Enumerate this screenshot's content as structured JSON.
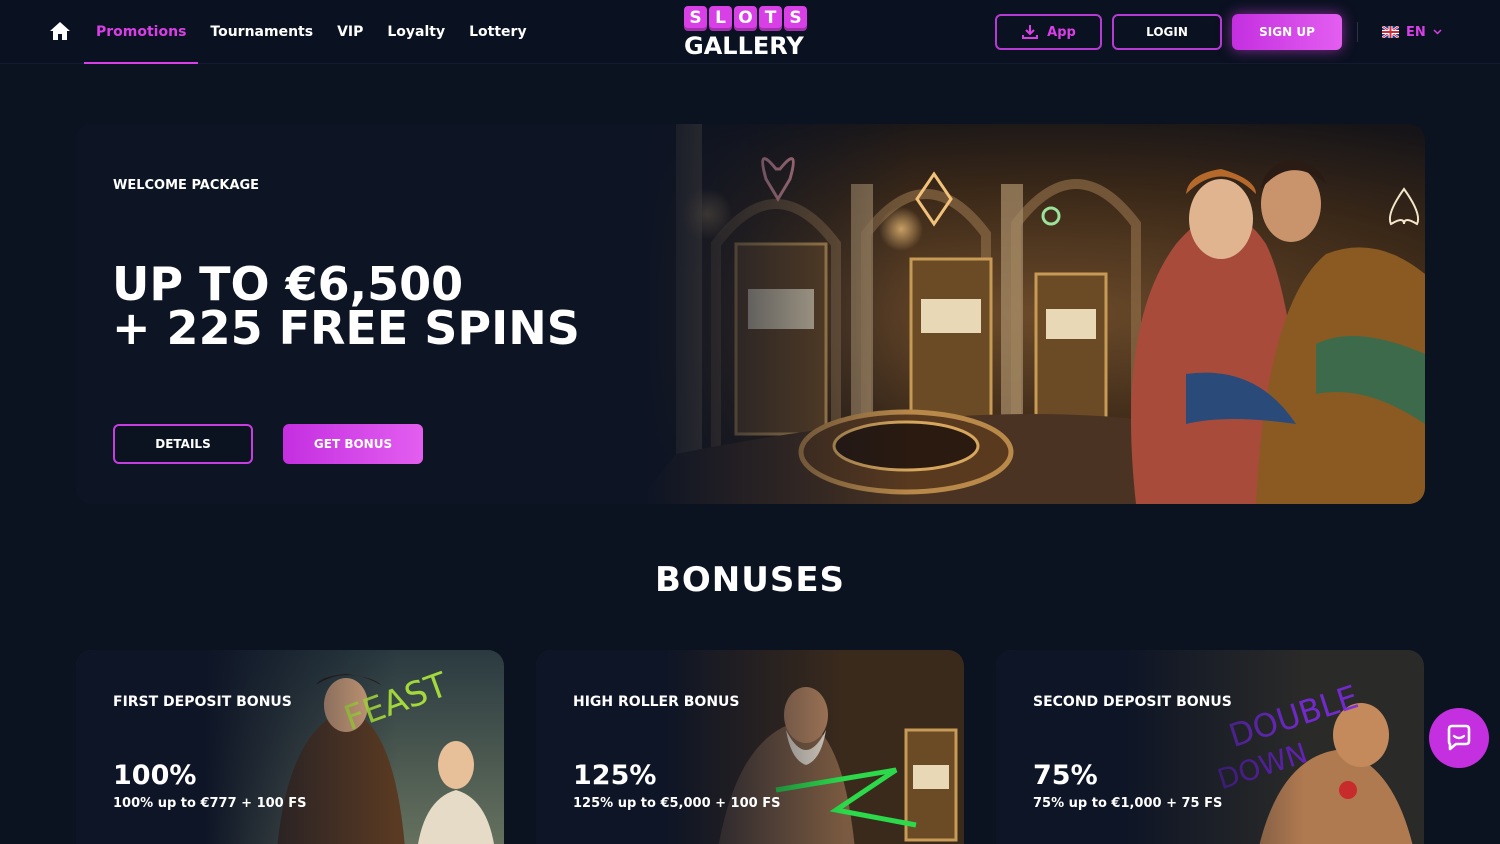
{
  "header": {
    "nav": [
      {
        "label": "Promotions"
      },
      {
        "label": "Tournaments"
      },
      {
        "label": "VIP"
      },
      {
        "label": "Loyalty"
      },
      {
        "label": "Lottery"
      }
    ],
    "logo": {
      "top_letters": [
        "S",
        "L",
        "O",
        "T",
        "S"
      ],
      "bottom": "GALLERY"
    },
    "app_label": "App",
    "login_label": "LOGIN",
    "signup_label": "SIGN UP",
    "language": "EN"
  },
  "hero": {
    "eyebrow": "WELCOME PACKAGE",
    "title_line1": "UP TO €6,500",
    "title_line2": "+ 225 FREE SPINS",
    "details_label": "DETAILS",
    "get_bonus_label": "GET BONUS"
  },
  "bonuses": {
    "title": "BONUSES",
    "cards": [
      {
        "title": "FIRST DEPOSIT BONUS",
        "percent": "100%",
        "description": "100% up to €777 + 100 FS"
      },
      {
        "title": "HIGH ROLLER BONUS",
        "percent": "125%",
        "description": "125% up to €5,000 + 100 FS"
      },
      {
        "title": "SECOND DEPOSIT BONUS",
        "percent": "75%",
        "description": "75% up to €1,000 + 75 FS"
      }
    ]
  },
  "colors": {
    "accent": "#d93fe6",
    "background": "#0b1220"
  }
}
